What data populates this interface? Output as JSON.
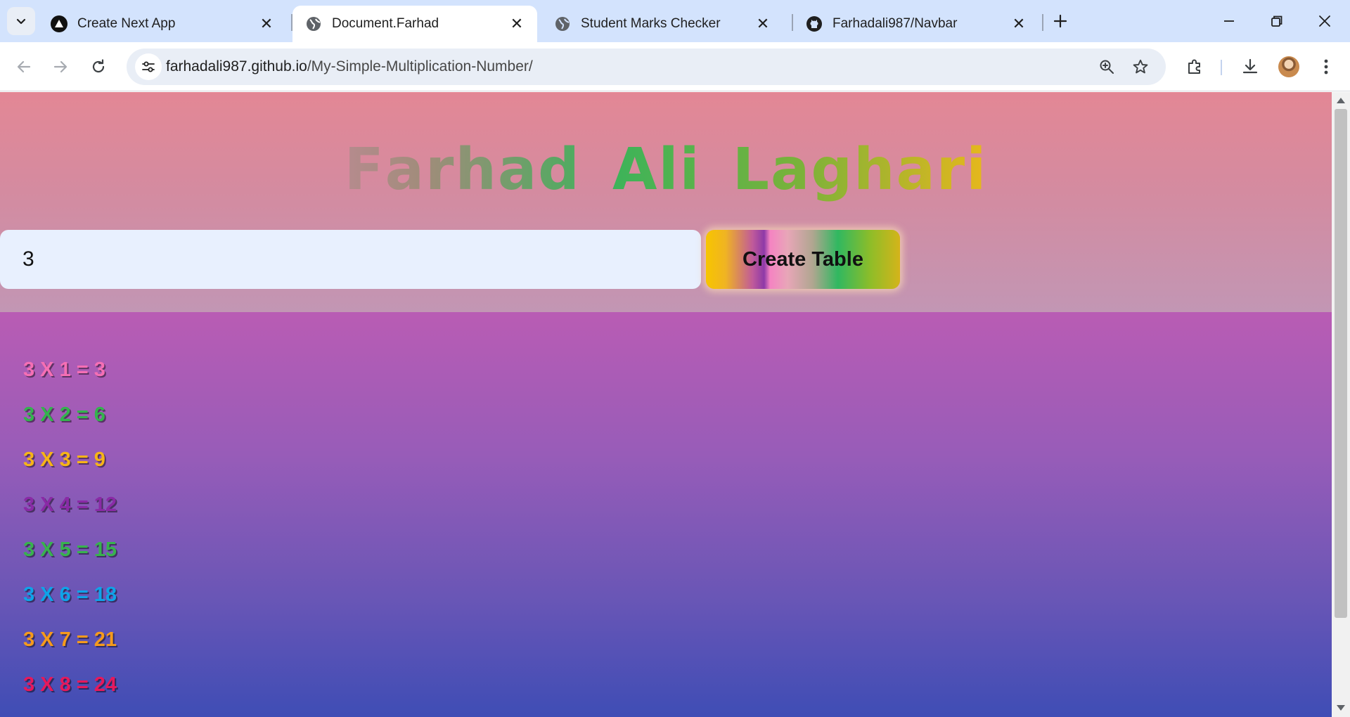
{
  "browser": {
    "tabs": [
      {
        "title": "Create Next App",
        "icon": "triangle-logo-icon",
        "active": false
      },
      {
        "title": "Document.Farhad",
        "icon": "globe-icon",
        "active": true
      },
      {
        "title": "Student Marks Checker",
        "icon": "globe-icon",
        "active": false
      },
      {
        "title": "Farhadali987/Navbar",
        "icon": "github-icon",
        "active": false
      }
    ],
    "close_glyph": "✕",
    "address": {
      "host": "farhadali987.github.io",
      "path": "/My-Simple-Multiplication-Number/"
    }
  },
  "page": {
    "title_letters": [
      "F",
      "a",
      "r",
      "h",
      "a",
      "d",
      " ",
      "A",
      "l",
      "i",
      " ",
      "L",
      "a",
      "g",
      "h",
      "a",
      "r",
      "i"
    ],
    "input_value": "3",
    "button_label": "Create Table",
    "rows": [
      {
        "text": "3 X 1 = 3",
        "color": "#f56fb4"
      },
      {
        "text": "3 X 2 = 6",
        "color": "#34b34e"
      },
      {
        "text": "3 X 3 = 9",
        "color": "#f6b417"
      },
      {
        "text": "3 X 4 = 12",
        "color": "#8a2aa6"
      },
      {
        "text": "3 X 5 = 15",
        "color": "#38b24e"
      },
      {
        "text": "3 X 6 = 18",
        "color": "#0fa3e8"
      },
      {
        "text": "3 X 7 = 21",
        "color": "#f59a1c"
      },
      {
        "text": "3 X 8 = 24",
        "color": "#e5195c"
      }
    ]
  }
}
